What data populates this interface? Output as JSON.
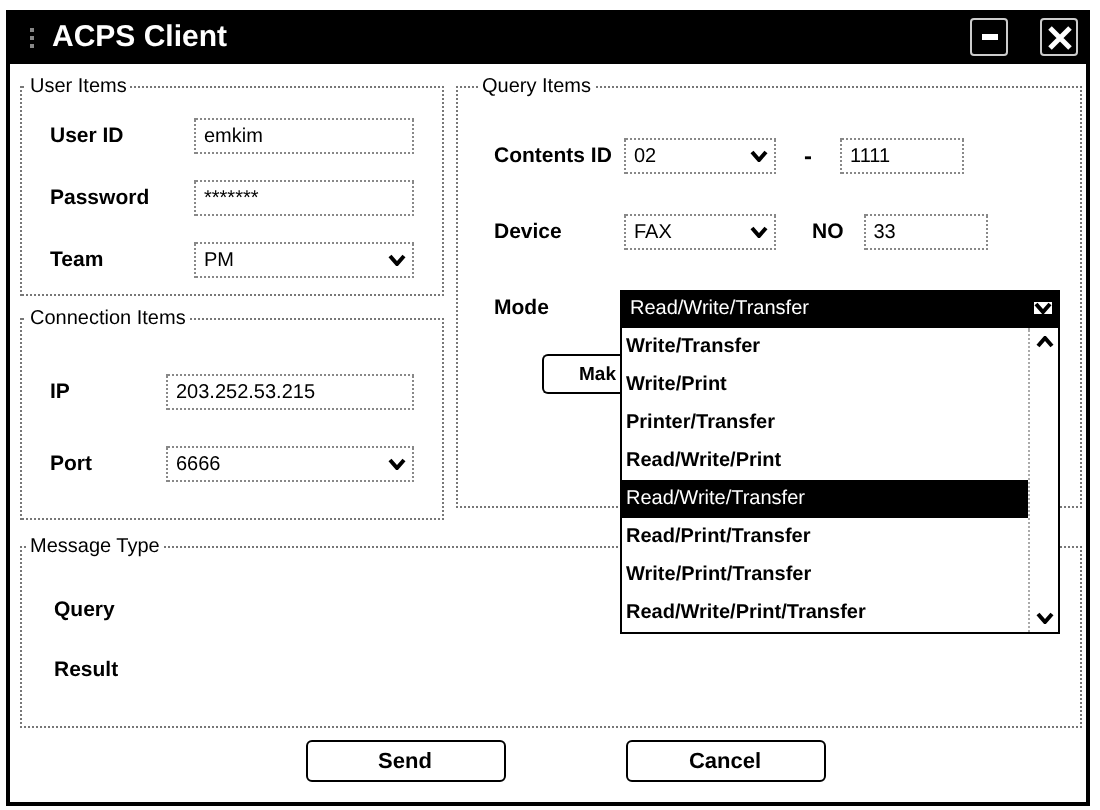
{
  "window": {
    "title": "ACPS Client"
  },
  "user_items": {
    "title": "User Items",
    "fields": [
      {
        "label": "User ID",
        "kind": "text",
        "value": "emkim"
      },
      {
        "label": "Password",
        "kind": "text",
        "value": "*******"
      },
      {
        "label": "Team",
        "kind": "select",
        "value": "PM"
      }
    ]
  },
  "connection_items": {
    "title": "Connection Items",
    "fields": [
      {
        "label": "IP",
        "kind": "text",
        "value": "203.252.53.215"
      },
      {
        "label": "Port",
        "kind": "select",
        "value": "6666"
      }
    ]
  },
  "query_items": {
    "title": "Query Items",
    "contents_id": {
      "label": "Contents ID",
      "value": "02",
      "separator": "-",
      "number": "1111"
    },
    "device": {
      "label": "Device",
      "value": "FAX",
      "no_label": "NO",
      "no_value": "33"
    },
    "mode": {
      "label": "Mode",
      "value": "Read/Write/Transfer",
      "options": [
        {
          "label": "Write/Transfer",
          "selected": false
        },
        {
          "label": "Write/Print",
          "selected": false
        },
        {
          "label": "Printer/Transfer",
          "selected": false
        },
        {
          "label": "Read/Write/Print",
          "selected": false
        },
        {
          "label": "Read/Write/Transfer",
          "selected": true
        },
        {
          "label": "Read/Print/Transfer",
          "selected": false
        },
        {
          "label": "Write/Print/Transfer",
          "selected": false
        },
        {
          "label": "Read/Write/Print/Transfer",
          "selected": false
        }
      ]
    },
    "make_button": "Mak"
  },
  "message_type": {
    "title": "Message Type",
    "labels": [
      "Query",
      "Result"
    ]
  },
  "buttons": [
    "Send",
    "Cancel"
  ]
}
